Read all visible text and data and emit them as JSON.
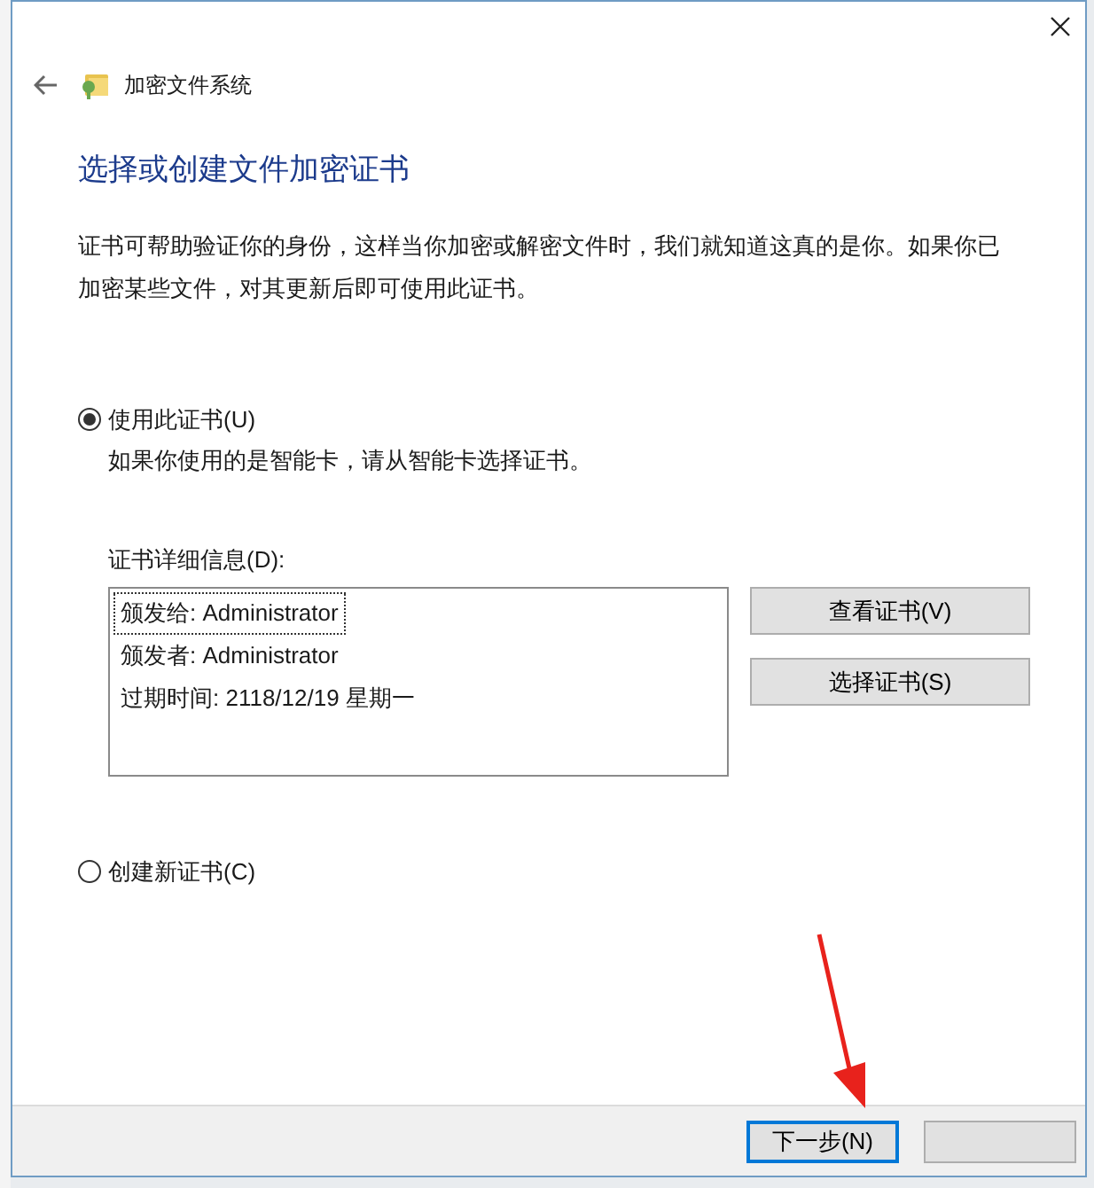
{
  "window": {
    "title": "加密文件系统"
  },
  "heading": "选择或创建文件加密证书",
  "description": "证书可帮助验证你的身份，这样当你加密或解密文件时，我们就知道这真的是你。如果你已加密某些文件，对其更新后即可使用此证书。",
  "options": [
    {
      "label": "使用此证书(U)",
      "selected": true,
      "hint": "如果你使用的是智能卡，请从智能卡选择证书。",
      "details": {
        "label": "证书详细信息(D):",
        "lines": [
          {
            "text": "颁发给: Administrator",
            "focused": true
          },
          {
            "text": "颁发者: Administrator",
            "focused": false
          },
          {
            "text": "过期时间: 2118/12/19 星期一",
            "focused": false
          }
        ],
        "buttons": [
          "查看证书(V)",
          "选择证书(S)"
        ]
      }
    },
    {
      "label": "创建新证书(C)",
      "selected": false
    }
  ],
  "footer": {
    "buttons": [
      {
        "label": "下一步(N)",
        "default": true
      },
      {
        "default": false
      }
    ]
  }
}
